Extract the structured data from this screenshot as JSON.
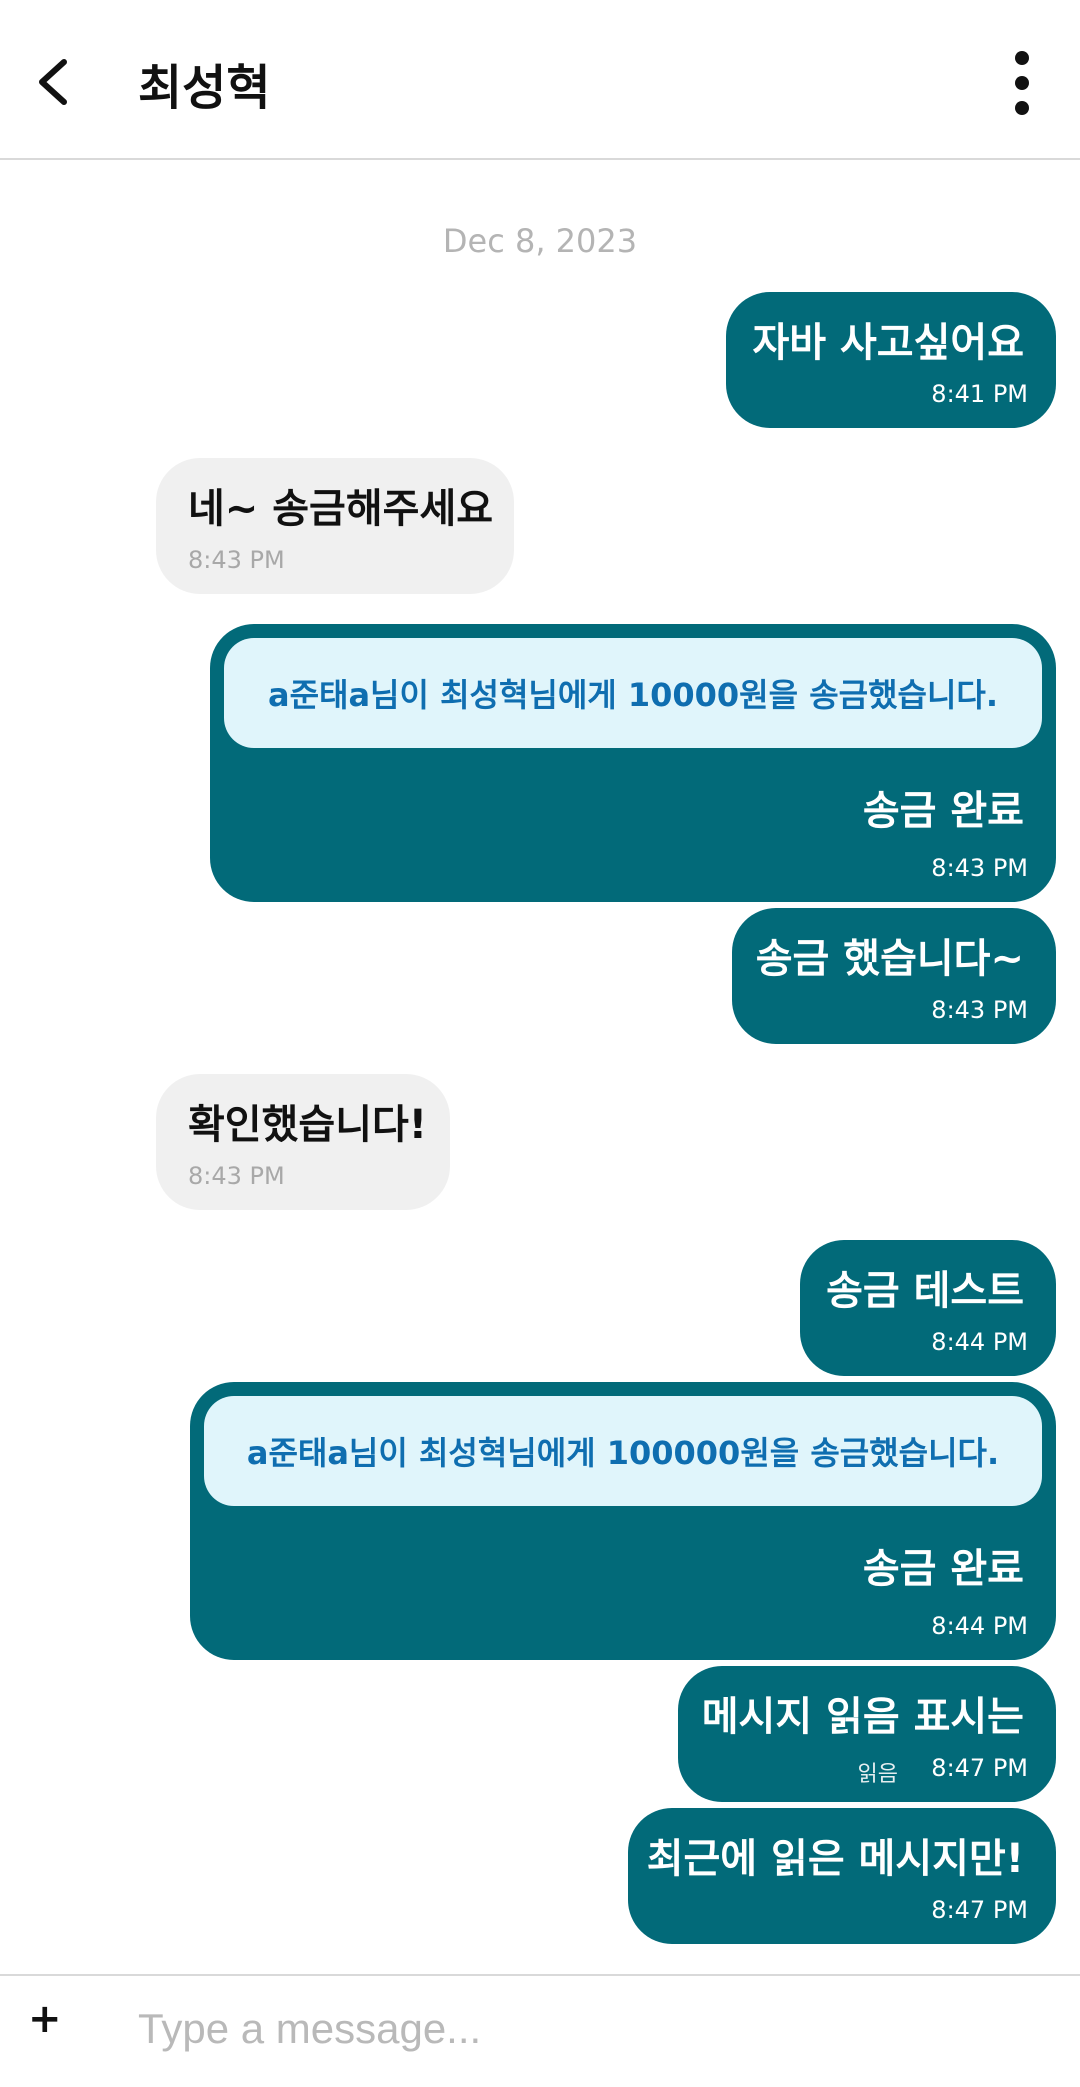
{
  "header": {
    "title": "최성혁",
    "back_icon": "chevron-left-icon",
    "menu_icon": "more-vertical-icon"
  },
  "date_separator": "Dec 8, 2023",
  "messages": [
    {
      "text": "자바 사고싶어요",
      "time": "8:41 PM"
    },
    {
      "text": "네~ 송금해주세요",
      "time": "8:43 PM"
    },
    {
      "note": "a준태a님이 최성혁님에게 10000원을 송금했습니다.",
      "text": "송금 완료",
      "time": "8:43 PM"
    },
    {
      "text": "송금 했습니다~",
      "time": "8:43 PM"
    },
    {
      "text": "확인했습니다!",
      "time": "8:43 PM"
    },
    {
      "text": "송금 테스트",
      "time": "8:44 PM"
    },
    {
      "note": "a준태a님이 최성혁님에게 100000원을 송금했습니다.",
      "text": "송금 완료",
      "time": "8:44 PM"
    },
    {
      "text": "메시지 읽음 표시는",
      "read": "읽음",
      "time": "8:47 PM"
    },
    {
      "text": "최근에 읽은 메시지만!",
      "time": "8:47 PM"
    }
  ],
  "composer": {
    "placeholder": "Type a message...",
    "attach_label": "+"
  },
  "colors": {
    "outgoing": "#026a79",
    "incoming": "#f0f0f0",
    "transfer_note_bg": "#e0f5fb",
    "transfer_note_text": "#0f6eb0"
  }
}
